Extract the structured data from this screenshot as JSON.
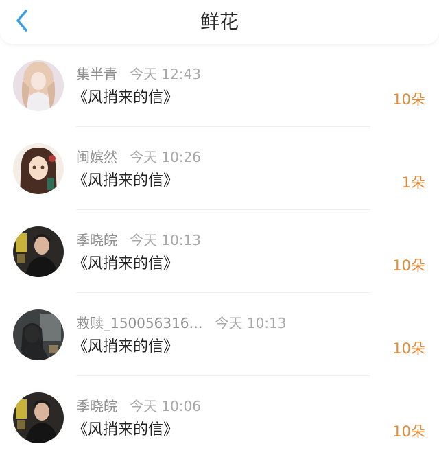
{
  "header": {
    "title": "鲜花",
    "back_icon": "chevron-left-icon",
    "accent": "#3aa0e8"
  },
  "colors": {
    "count": "#e08a3a",
    "meta": "#8e8e8e",
    "text": "#222222"
  },
  "items": [
    {
      "name": "集半青",
      "time": "今天 12:43",
      "book": "《风捎来的信》",
      "count": "10朵"
    },
    {
      "name": "闽嫔然",
      "time": "今天 10:26",
      "book": "《风捎来的信》",
      "count": "1朵"
    },
    {
      "name": "季晓皖",
      "time": "今天 10:13",
      "book": "《风捎来的信》",
      "count": "10朵"
    },
    {
      "name": "救赎_150056316…",
      "time": "今天 10:13",
      "book": "《风捎来的信》",
      "count": "10朵"
    },
    {
      "name": "季晓皖",
      "time": "今天 10:06",
      "book": "《风捎来的信》",
      "count": "10朵"
    }
  ]
}
